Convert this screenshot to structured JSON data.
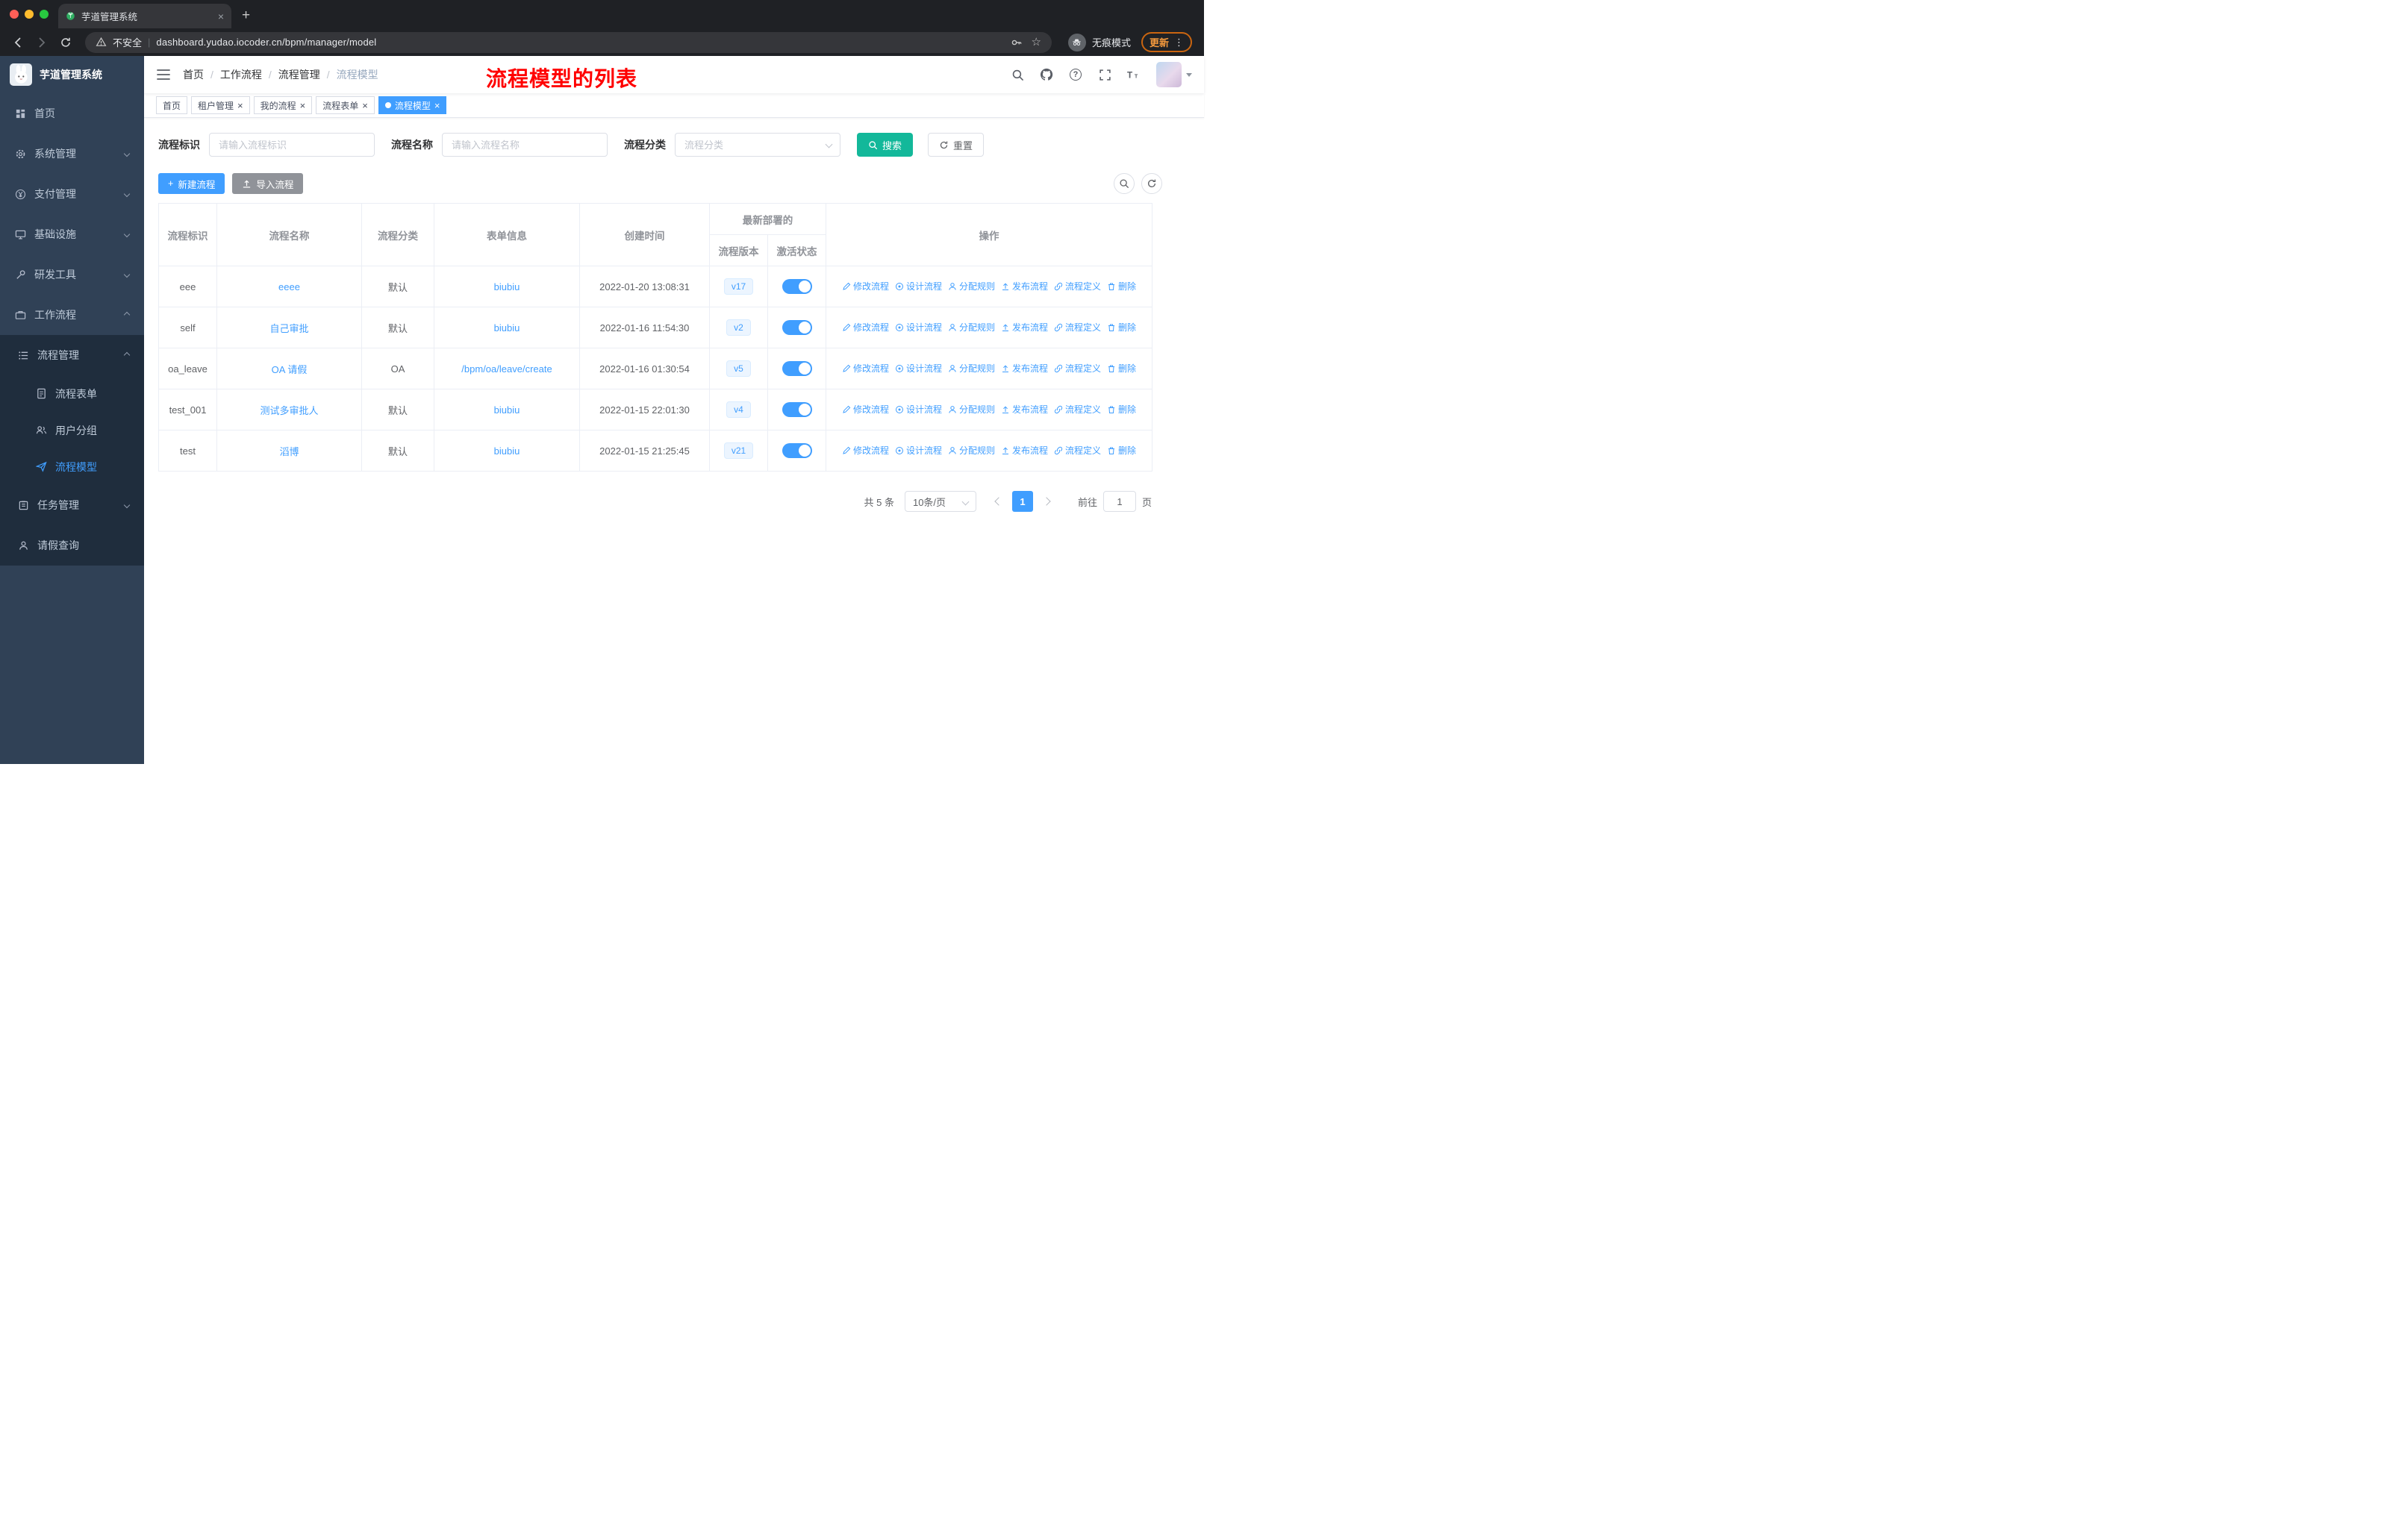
{
  "browser": {
    "tab_title": "芋道管理系统",
    "security_label": "不安全",
    "url": "dashboard.yudao.iocoder.cn/bpm/manager/model",
    "incognito_label": "无痕模式",
    "update_label": "更新"
  },
  "sidebar": {
    "logo_title": "芋道管理系统",
    "items": [
      {
        "label": "首页"
      },
      {
        "label": "系统管理"
      },
      {
        "label": "支付管理"
      },
      {
        "label": "基础设施"
      },
      {
        "label": "研发工具"
      },
      {
        "label": "工作流程"
      }
    ],
    "submenu": {
      "process_mgmt": "流程管理",
      "children": [
        {
          "label": "流程表单"
        },
        {
          "label": "用户分组"
        },
        {
          "label": "流程模型"
        }
      ],
      "task_mgmt": "任务管理",
      "leave_query": "请假查询"
    }
  },
  "navbar": {
    "breadcrumb": [
      {
        "label": "首页"
      },
      {
        "label": "工作流程"
      },
      {
        "label": "流程管理"
      },
      {
        "label": "流程模型"
      }
    ],
    "annotation": "流程模型的列表"
  },
  "tags": [
    {
      "label": "首页",
      "closable": false,
      "active": false
    },
    {
      "label": "租户管理",
      "closable": true,
      "active": false
    },
    {
      "label": "我的流程",
      "closable": true,
      "active": false
    },
    {
      "label": "流程表单",
      "closable": true,
      "active": false
    },
    {
      "label": "流程模型",
      "closable": true,
      "active": true
    }
  ],
  "filters": {
    "id_label": "流程标识",
    "id_placeholder": "请输入流程标识",
    "name_label": "流程名称",
    "name_placeholder": "请输入流程名称",
    "category_label": "流程分类",
    "category_placeholder": "流程分类",
    "search_label": "搜索",
    "reset_label": "重置"
  },
  "toolbar": {
    "create_label": "新建流程",
    "import_label": "导入流程"
  },
  "table": {
    "headers": {
      "id": "流程标识",
      "name": "流程名称",
      "category": "流程分类",
      "form": "表单信息",
      "created": "创建时间",
      "deployed_group": "最新部署的",
      "version": "流程版本",
      "active": "激活状态",
      "ops": "操作"
    },
    "actions": [
      {
        "label": "修改流程"
      },
      {
        "label": "设计流程"
      },
      {
        "label": "分配规则"
      },
      {
        "label": "发布流程"
      },
      {
        "label": "流程定义"
      },
      {
        "label": "删除"
      }
    ],
    "rows": [
      {
        "id": "eee",
        "name": "eeee",
        "category": "默认",
        "form": "biubiu",
        "created": "2022-01-20 13:08:31",
        "version": "v17",
        "active": true
      },
      {
        "id": "self",
        "name": "自己审批",
        "category": "默认",
        "form": "biubiu",
        "created": "2022-01-16 11:54:30",
        "version": "v2",
        "active": true
      },
      {
        "id": "oa_leave",
        "name": "OA 请假",
        "category": "OA",
        "form": "/bpm/oa/leave/create",
        "created": "2022-01-16 01:30:54",
        "version": "v5",
        "active": true
      },
      {
        "id": "test_001",
        "name": "测试多审批人",
        "category": "默认",
        "form": "biubiu",
        "created": "2022-01-15 22:01:30",
        "version": "v4",
        "active": true
      },
      {
        "id": "test",
        "name": "滔博",
        "category": "默认",
        "form": "biubiu",
        "created": "2022-01-15 21:25:45",
        "version": "v21",
        "active": true
      }
    ]
  },
  "pagination": {
    "total": "共 5 条",
    "page_size": "10条/页",
    "page": "1",
    "goto_label": "前往",
    "goto_value": "1",
    "unit_label": "页"
  },
  "theme": {
    "accent": "#409eff",
    "search_button": "#13b89a",
    "sidebar_bg": "#304156",
    "submenu_bg": "#1f2d3d",
    "annotation_red": "#ff0000",
    "version_tag_bg": "#ecf5ff"
  }
}
